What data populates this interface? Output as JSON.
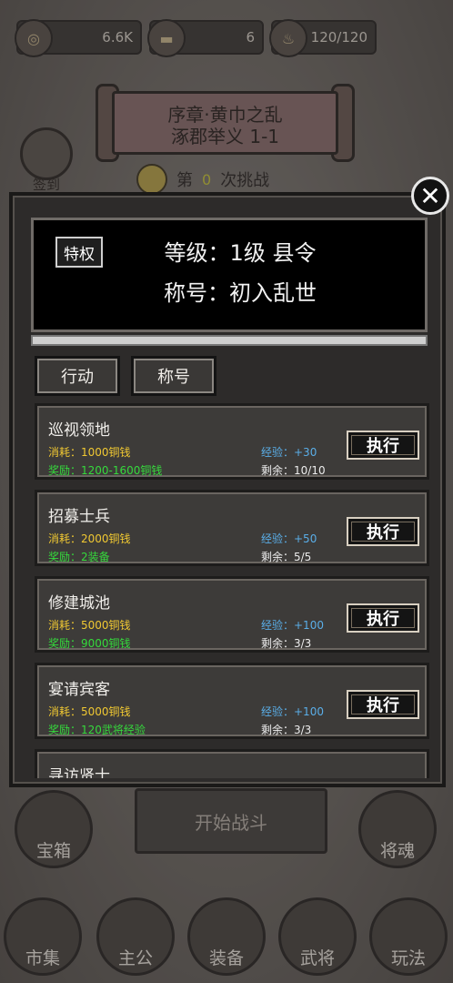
{
  "resources": [
    {
      "icon": "coin-icon",
      "value": "6.6K"
    },
    {
      "icon": "ingot-icon",
      "value": "6"
    },
    {
      "icon": "food-sack-icon",
      "value": "120/120"
    }
  ],
  "stage": {
    "line1": "序章·黄巾之乱",
    "line2": "涿郡举义 1-1"
  },
  "signin_label": "签到",
  "challenge": {
    "prefix": "第",
    "count": "0",
    "suffix": "次挑战"
  },
  "modal": {
    "privilege_label": "特权",
    "rank_text": "等级：1级 县令",
    "title_text": "称号：初入乱世",
    "progress": 0,
    "tabs": [
      {
        "label": "行动"
      },
      {
        "label": "称号"
      }
    ],
    "tasks": [
      {
        "name": "巡视领地",
        "cost": "消耗：1000铜钱",
        "reward": "奖励：1200-1600铜钱",
        "exp": "经验：+30",
        "remain": "剩余：10/10",
        "button": "执行"
      },
      {
        "name": "招募士兵",
        "cost": "消耗：2000铜钱",
        "reward": "奖励：2装备",
        "exp": "经验：+50",
        "remain": "剩余：5/5",
        "button": "执行"
      },
      {
        "name": "修建城池",
        "cost": "消耗：5000铜钱",
        "reward": "奖励：9000铜钱",
        "exp": "经验：+100",
        "remain": "剩余：3/3",
        "button": "执行"
      },
      {
        "name": "宴请宾客",
        "cost": "消耗：5000铜钱",
        "reward": "奖励：120武将经验",
        "exp": "经验：+100",
        "remain": "剩余：3/3",
        "button": "执行"
      },
      {
        "name": "寻访贤士",
        "cost": "",
        "reward": "",
        "exp": "",
        "remain": "",
        "button": ""
      }
    ],
    "close_symbol": "✕"
  },
  "start_battle": "开始战斗",
  "side_buttons": [
    {
      "label": "宝箱"
    },
    {
      "label": "将魂"
    }
  ],
  "bottom_nav": [
    {
      "label": "市集"
    },
    {
      "label": "主公"
    },
    {
      "label": "装备"
    },
    {
      "label": "武将"
    },
    {
      "label": "玩法"
    }
  ]
}
